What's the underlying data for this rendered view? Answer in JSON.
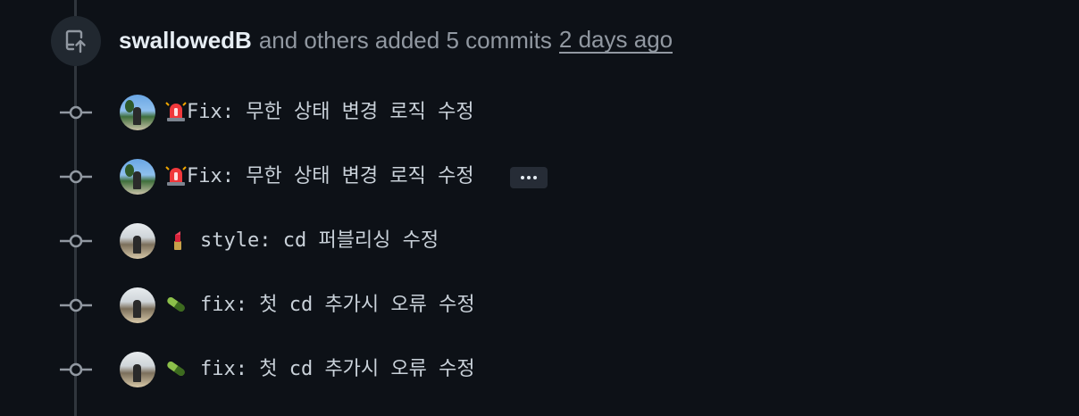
{
  "event": {
    "author": "swallowedB",
    "description": "and others added 5 commits",
    "time": "2 days ago",
    "icon": "repo-push-icon"
  },
  "commits": [
    {
      "emoji": "rotating-light-icon",
      "message": "Fix: 무한 상태 변경 로직 수정",
      "avatar": "beach-avatar"
    },
    {
      "emoji": "rotating-light-icon",
      "message": "Fix: 무한 상태 변경 로직 수정",
      "avatar": "beach-avatar",
      "has_more_button": true
    },
    {
      "emoji": "lipstick-icon",
      "message": "style: cd 퍼블리싱 수정",
      "avatar": "plaza-avatar"
    },
    {
      "emoji": "pill-icon",
      "message": "fix: 첫 cd 추가시 오류 수정",
      "avatar": "plaza-avatar"
    },
    {
      "emoji": "pill-icon",
      "message": "fix: 첫 cd 추가시 오류 수정",
      "avatar": "plaza-avatar"
    }
  ],
  "colors": {
    "background": "#0d1117",
    "muted_text": "#9198a1",
    "timeline": "#30363d",
    "icon_circle": "#212830",
    "siren_red": "#f0383b",
    "pill_green": "#8cc04a"
  }
}
